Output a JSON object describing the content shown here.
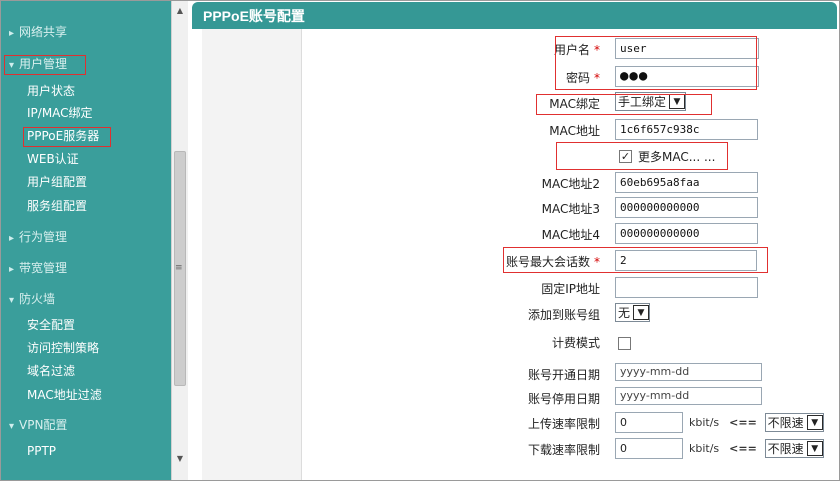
{
  "sidebar": {
    "items": [
      {
        "label": "网络共享",
        "type": "section"
      },
      {
        "label": "用户管理",
        "type": "section"
      },
      {
        "label": "用户状态",
        "type": "sub"
      },
      {
        "label": "IP/MAC绑定",
        "type": "sub"
      },
      {
        "label": "PPPoE服务器",
        "type": "sub"
      },
      {
        "label": "WEB认证",
        "type": "sub"
      },
      {
        "label": "用户组配置",
        "type": "sub"
      },
      {
        "label": "服务组配置",
        "type": "sub"
      },
      {
        "label": "行为管理",
        "type": "section"
      },
      {
        "label": "带宽管理",
        "type": "section"
      },
      {
        "label": "防火墙",
        "type": "section"
      },
      {
        "label": "安全配置",
        "type": "sub"
      },
      {
        "label": "访问控制策略",
        "type": "sub"
      },
      {
        "label": "域名过滤",
        "type": "sub"
      },
      {
        "label": "MAC地址过滤",
        "type": "sub"
      },
      {
        "label": "VPN配置",
        "type": "section"
      },
      {
        "label": "PPTP",
        "type": "sub"
      }
    ]
  },
  "panel": {
    "title": "PPPoE账号配置"
  },
  "form": {
    "username": {
      "label": "用户名",
      "value": "user"
    },
    "password": {
      "label": "密码",
      "value": "●●●"
    },
    "mac_bind": {
      "label": "MAC绑定",
      "value": "手工绑定"
    },
    "mac": {
      "label": "MAC地址",
      "value": "1c6f657c938c"
    },
    "more_mac": {
      "label": "更多MAC... ...",
      "checked": true
    },
    "mac2": {
      "label": "MAC地址2",
      "value": "60eb695a8faa"
    },
    "mac3": {
      "label": "MAC地址3",
      "value": "000000000000"
    },
    "mac4": {
      "label": "MAC地址4",
      "value": "000000000000"
    },
    "max_sessions": {
      "label": "账号最大会话数",
      "value": "2"
    },
    "fixed_ip": {
      "label": "固定IP地址",
      "value": ""
    },
    "account_group": {
      "label": "添加到账号组",
      "value": "无"
    },
    "billing": {
      "label": "计费模式",
      "checked": false
    },
    "open_date": {
      "label": "账号开通日期",
      "value": "yyyy-mm-dd"
    },
    "stop_date": {
      "label": "账号停用日期",
      "value": "yyyy-mm-dd"
    },
    "upload_limit": {
      "label": "上传速率限制",
      "value": "0",
      "unit": "kbit/s",
      "arrow": "<==",
      "option": "不限速"
    },
    "download_limit": {
      "label": "下载速率限制",
      "value": "0",
      "unit": "kbit/s",
      "arrow": "<==",
      "option": "不限速"
    },
    "required_mark": "*"
  }
}
